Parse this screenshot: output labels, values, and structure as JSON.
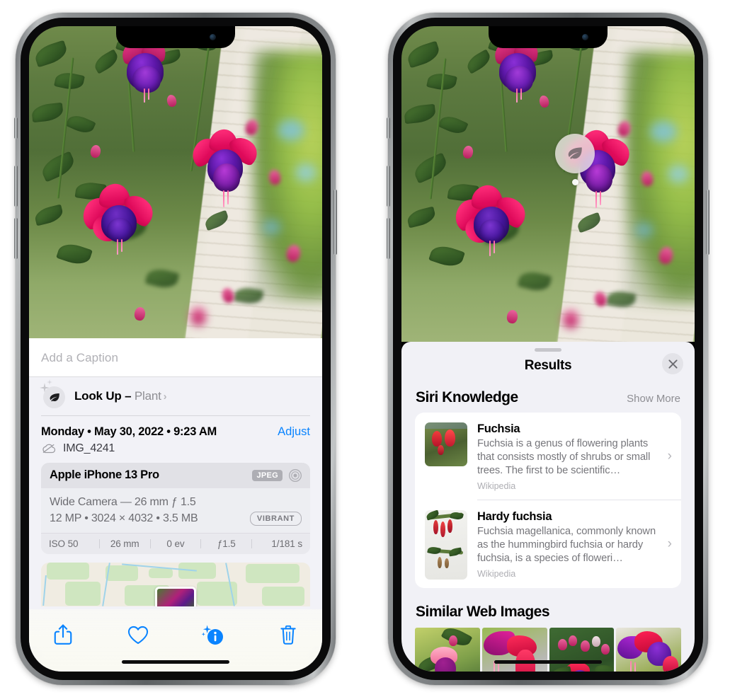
{
  "left_phone": {
    "caption": {
      "placeholder": "Add a Caption",
      "value": ""
    },
    "lookup": {
      "label": "Look Up – ",
      "subject": "Plant",
      "chevron": "›",
      "icon": "leaf-icon"
    },
    "datetime": "Monday • May 30, 2022 • 9:23 AM",
    "adjust_label": "Adjust",
    "filename": "IMG_4241",
    "cloud_icon": "icloud-slash-icon",
    "exif": {
      "device": "Apple iPhone 13 Pro",
      "format_badge": "JPEG",
      "lens_icon": "aperture-icon",
      "lens_line": "Wide Camera — 26 mm ƒ 1.5",
      "size_line": "12 MP • 3024 × 4032 • 3.5 MB",
      "style_chip": "VIBRANT",
      "stats": [
        "ISO 50",
        "26 mm",
        "0 ev",
        "ƒ1.5",
        "1/181 s"
      ]
    },
    "toolbar": [
      {
        "name": "share-button",
        "icon": "share-icon"
      },
      {
        "name": "favorite-button",
        "icon": "heart-icon"
      },
      {
        "name": "info-button",
        "icon": "info-sparkle-icon"
      },
      {
        "name": "delete-button",
        "icon": "trash-icon"
      }
    ],
    "colors": {
      "accent": "#0a84ff",
      "sheet_bg": "#f2f2f7",
      "card_bg": "#e9e9ee"
    }
  },
  "right_phone": {
    "badge": {
      "icon": "leaf-icon",
      "name": "visual-look-up-badge"
    },
    "results_title": "Results",
    "close_icon": "close-icon",
    "siri_knowledge": {
      "title": "Siri Knowledge",
      "action": "Show More",
      "items": [
        {
          "title": "Fuchsia",
          "description": "Fuchsia is a genus of flowering plants that consists mostly of shrubs or small trees. The first to be scientific…",
          "source": "Wikipedia",
          "chevron": "›"
        },
        {
          "title": "Hardy fuchsia",
          "description": "Fuchsia magellanica, commonly known as the hummingbird fuchsia or hardy fuchsia, is a species of floweri…",
          "source": "Wikipedia",
          "chevron": "›"
        }
      ]
    },
    "similar_web_images": {
      "title": "Similar Web Images",
      "thumbnails": [
        "fuchsia-thumb-1",
        "fuchsia-thumb-2",
        "fuchsia-thumb-3",
        "fuchsia-thumb-4"
      ]
    },
    "colors": {
      "sheet_bg": "#f1f1f6",
      "card_bg": "#ffffff",
      "muted_text": "#8e8e93"
    }
  }
}
